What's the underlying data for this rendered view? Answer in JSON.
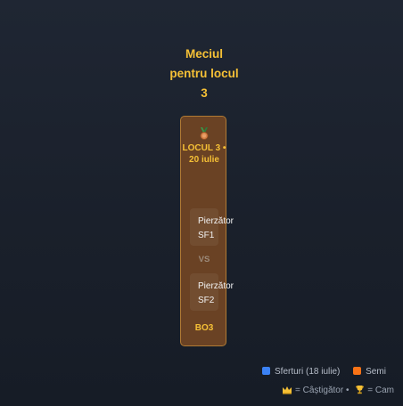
{
  "match": {
    "title": "Meciul pentru locul 3",
    "header": "LOCUL 3 • 20 iulie",
    "medal_icon": "bronze-medal-icon",
    "team_one": "Pierzător SF1",
    "vs": "VS",
    "team_two": "Pierzător SF2",
    "format": "BO3",
    "colors": {
      "accent": "#f5c036",
      "card_background": "#6a4224",
      "card_border": "#b07a34"
    }
  },
  "legend": {
    "items": [
      {
        "label": "Sferturi (18 iulie)",
        "color": "#3b82f6"
      },
      {
        "label": "Semi",
        "color": "#f97316"
      }
    ],
    "symbols": [
      {
        "icon": "crown-icon",
        "text": "= Câștigător •"
      },
      {
        "icon": "trophy-icon",
        "text": "= Cam"
      }
    ]
  }
}
